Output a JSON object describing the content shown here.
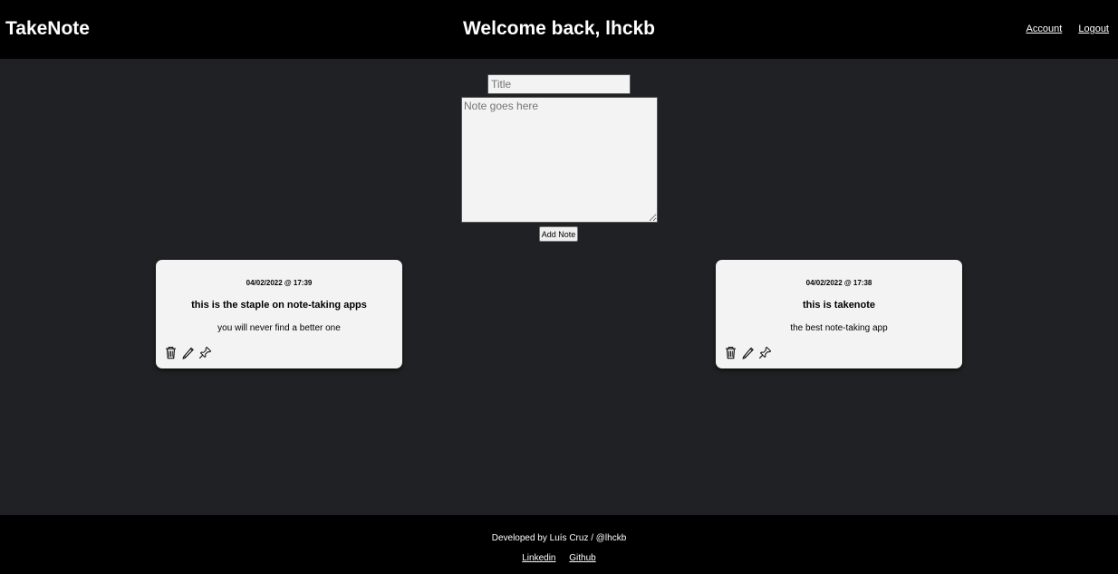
{
  "header": {
    "brand": "TakeNote",
    "welcome": "Welcome back, lhckb",
    "account_link": "Account",
    "logout_link": "Logout"
  },
  "composer": {
    "title_placeholder": "Title",
    "title_value": "",
    "note_placeholder": "Note goes here",
    "note_value": "",
    "add_button": "Add Note"
  },
  "notes": [
    {
      "date": "04/02/2022 @ 17:39",
      "title": "this is the staple on note-taking apps",
      "body": "you will never find a better one",
      "actions": [
        "trash-icon",
        "pencil-icon",
        "pin-icon"
      ]
    },
    {
      "date": "04/02/2022 @ 17:38",
      "title": "this is takenote",
      "body": "the best note-taking app",
      "actions": [
        "trash-icon",
        "pencil-icon",
        "pin-icon"
      ]
    }
  ],
  "footer": {
    "credit": "Developed by Luís Cruz / @lhckb",
    "linkedin": "Linkedin",
    "github": "Github"
  },
  "colors": {
    "header_background": "#000000",
    "page_background": "#202124",
    "card_background": "#f3f3f3",
    "text_light": "#ffffff"
  }
}
